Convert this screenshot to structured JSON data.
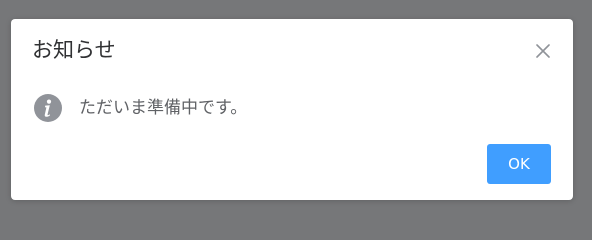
{
  "overlay": {
    "background": "#767779"
  },
  "dialog": {
    "title": "お知らせ",
    "close_icon": "close-icon",
    "message_icon": "info-icon",
    "message": "ただいま準備中です。",
    "ok_label": "OK",
    "colors": {
      "primary": "#409eff",
      "info_icon": "#909399",
      "title_text": "#303133",
      "message_text": "#606266"
    }
  }
}
